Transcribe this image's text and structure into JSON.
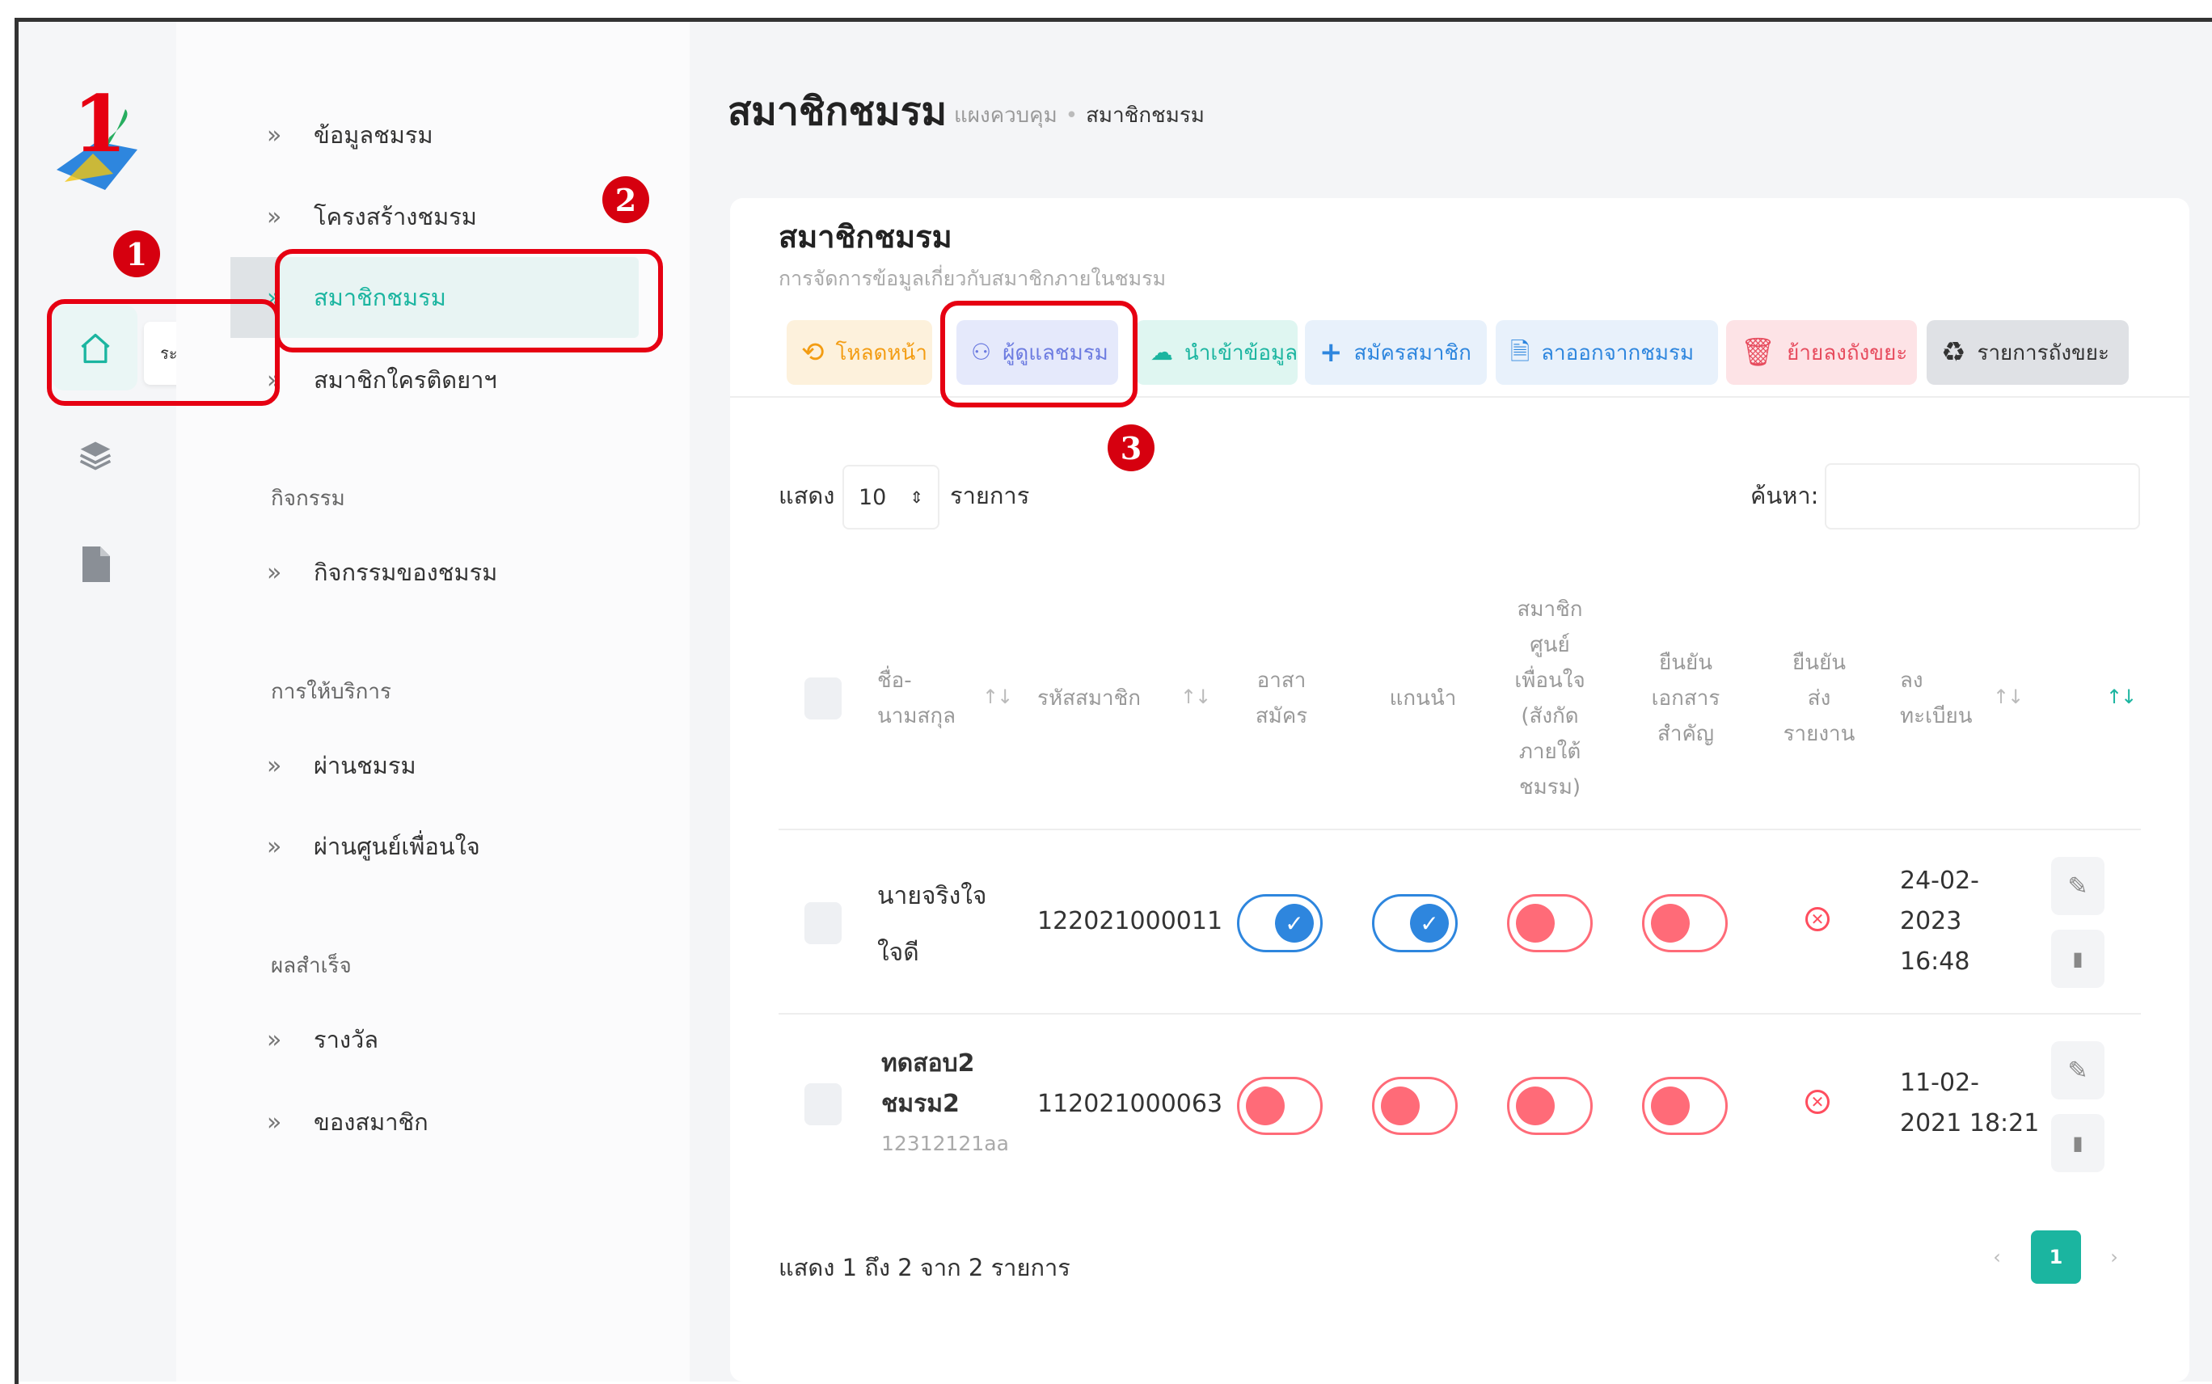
{
  "logo": {
    "text": "1"
  },
  "rail": {
    "home_tooltip": "ระดับชมรม"
  },
  "sidebar": {
    "items": [
      {
        "label": "ข้อมูลชมรม"
      },
      {
        "label": "โครงสร้างชมรม"
      },
      {
        "label": "สมาชิกชมรม"
      },
      {
        "label": "สมาชิกใครติดยาฯ"
      }
    ],
    "sections": [
      {
        "header": "กิจกรรม",
        "items": [
          {
            "label": "กิจกรรมของชมรม"
          }
        ]
      },
      {
        "header": "การให้บริการ",
        "items": [
          {
            "label": "ผ่านชมรม"
          },
          {
            "label": "ผ่านศูนย์เพื่อนใจ"
          }
        ]
      },
      {
        "header": "ผลสำเร็จ",
        "items": [
          {
            "label": "รางวัล"
          },
          {
            "label": "ของสมาชิก"
          }
        ]
      }
    ]
  },
  "annotations": {
    "m1": "1",
    "m2": "2",
    "m3": "3"
  },
  "header": {
    "title": "สมาชิกชมรม",
    "breadcrumb": {
      "home": "แผงควบคุม",
      "current": "สมาชิกชมรม"
    }
  },
  "card": {
    "title": "สมาชิกชมรม",
    "subtitle": "การจัดการข้อมูลเกี่ยวกับสมาชิกภายในชมรม"
  },
  "toolbar": {
    "reload": "โหลดหน้า",
    "managers": "ผู้ดูแลชมรม",
    "import": "นำเข้าข้อมูล",
    "register": "สมัครสมาชิก",
    "leave": "ลาออกจากชมรม",
    "trash": "ย้ายลงถังขยะ",
    "trash_list": "รายการถังขยะ"
  },
  "table_controls": {
    "show_label": "แสดง",
    "page_size": "10",
    "items_label": "รายการ",
    "search_label": "ค้นหา:"
  },
  "table": {
    "headers": {
      "name": "ชื่อ-\nนามสกุล",
      "member_id": "รหัสสมาชิก",
      "volunteer": "อาสา\nสมัคร",
      "leader": "แกนนำ",
      "center_member": "สมาชิก\nศูนย์\nเพื่อนใจ\n(สังกัด\nภายใต้\nชมรม)",
      "doc_confirm": "ยืนยัน\nเอกสาร\nสำคัญ",
      "report_confirm": "ยืนยัน\nส่ง\nรายงาน",
      "registered": "ลง\nทะเบียน"
    },
    "rows": [
      {
        "name_line1": "นายจริงใจ",
        "name_line2": "ใจดี",
        "member_id": "122021000011",
        "volunteer": true,
        "leader": true,
        "center_member": false,
        "doc_confirm": false,
        "report_confirm": false,
        "date_line1": "24-02-",
        "date_line2": "2023",
        "date_line3": "16:48"
      },
      {
        "name_line1": "ทดสอบ2",
        "name_line2": "ชมรม2",
        "name_sub": "12312121aa",
        "member_id": "112021000063",
        "volunteer": false,
        "leader": false,
        "center_member": false,
        "doc_confirm": false,
        "report_confirm": false,
        "date_line1": "11-02-",
        "date_line2": "2021 18:21"
      }
    ]
  },
  "footer": {
    "info": "แสดง 1 ถึง 2 จาก 2 รายการ",
    "prev": "‹",
    "page": "1",
    "next": "›"
  },
  "colors": {
    "accent": "#1bb5a0",
    "annotation_red": "#e60012",
    "toggle_on": "#2e86de",
    "toggle_off": "#ff6b78"
  }
}
